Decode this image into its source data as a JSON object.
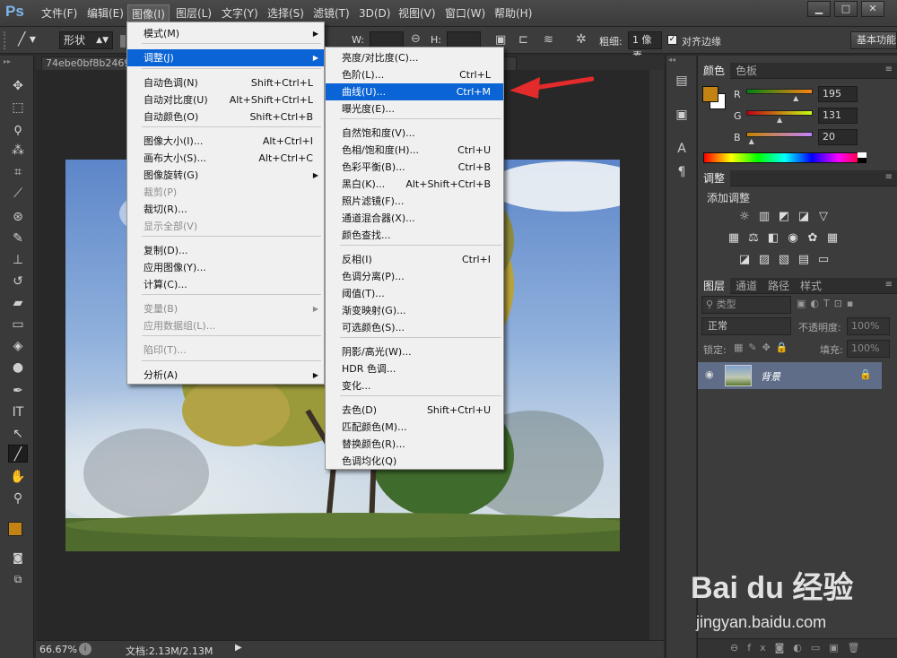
{
  "app": {
    "logo": "Ps"
  },
  "menubar": [
    "文件(F)",
    "编辑(E)",
    "图像(I)",
    "图层(L)",
    "文字(Y)",
    "选择(S)",
    "滤镜(T)",
    "3D(D)",
    "视图(V)",
    "窗口(W)",
    "帮助(H)"
  ],
  "window_controls": {
    "min": "▁",
    "max": "□",
    "close": "✕"
  },
  "options": {
    "shape_mode": "形状",
    "w_label": "W:",
    "h_label": "H:",
    "weight_label": "粗细:",
    "weight_value": "1 像素",
    "align_edges": "对齐边缘",
    "workspace": "基本功能"
  },
  "document": {
    "tab_title": "74ebe0bf8b24692",
    "zoom": "66.67%",
    "doc_info": "文档:2.13M/2.13M"
  },
  "image_menu": {
    "items": [
      {
        "label": "模式(M)",
        "shortcut": "",
        "submenu": true,
        "disabled": false
      },
      {
        "label": "调整(J)",
        "shortcut": "",
        "submenu": true,
        "disabled": false,
        "highlight": true
      },
      {
        "label": "自动色调(N)",
        "shortcut": "Shift+Ctrl+L",
        "disabled": false
      },
      {
        "label": "自动对比度(U)",
        "shortcut": "Alt+Shift+Ctrl+L",
        "disabled": false
      },
      {
        "label": "自动颜色(O)",
        "shortcut": "Shift+Ctrl+B",
        "disabled": false
      },
      {
        "label": "图像大小(I)...",
        "shortcut": "Alt+Ctrl+I",
        "disabled": false
      },
      {
        "label": "画布大小(S)...",
        "shortcut": "Alt+Ctrl+C",
        "disabled": false
      },
      {
        "label": "图像旋转(G)",
        "shortcut": "",
        "submenu": true,
        "disabled": false
      },
      {
        "label": "裁剪(P)",
        "shortcut": "",
        "disabled": true
      },
      {
        "label": "裁切(R)...",
        "shortcut": "",
        "disabled": false
      },
      {
        "label": "显示全部(V)",
        "shortcut": "",
        "disabled": true
      },
      {
        "label": "复制(D)...",
        "shortcut": "",
        "disabled": false
      },
      {
        "label": "应用图像(Y)...",
        "shortcut": "",
        "disabled": false
      },
      {
        "label": "计算(C)...",
        "shortcut": "",
        "disabled": false
      },
      {
        "label": "变量(B)",
        "shortcut": "",
        "submenu": true,
        "disabled": true
      },
      {
        "label": "应用数据组(L)...",
        "shortcut": "",
        "disabled": true
      },
      {
        "label": "陷印(T)...",
        "shortcut": "",
        "disabled": true
      },
      {
        "label": "分析(A)",
        "shortcut": "",
        "submenu": true,
        "disabled": false
      }
    ]
  },
  "adjust_menu": {
    "items": [
      {
        "label": "亮度/对比度(C)...",
        "shortcut": ""
      },
      {
        "label": "色阶(L)...",
        "shortcut": "Ctrl+L"
      },
      {
        "label": "曲线(U)...",
        "shortcut": "Ctrl+M",
        "highlight": true
      },
      {
        "label": "曝光度(E)...",
        "shortcut": ""
      },
      {
        "label": "自然饱和度(V)...",
        "shortcut": ""
      },
      {
        "label": "色相/饱和度(H)...",
        "shortcut": "Ctrl+U"
      },
      {
        "label": "色彩平衡(B)...",
        "shortcut": "Ctrl+B"
      },
      {
        "label": "黑白(K)...",
        "shortcut": "Alt+Shift+Ctrl+B"
      },
      {
        "label": "照片滤镜(F)...",
        "shortcut": ""
      },
      {
        "label": "通道混合器(X)...",
        "shortcut": ""
      },
      {
        "label": "颜色查找...",
        "shortcut": ""
      },
      {
        "label": "反相(I)",
        "shortcut": "Ctrl+I"
      },
      {
        "label": "色调分离(P)...",
        "shortcut": ""
      },
      {
        "label": "阈值(T)...",
        "shortcut": ""
      },
      {
        "label": "渐变映射(G)...",
        "shortcut": ""
      },
      {
        "label": "可选颜色(S)...",
        "shortcut": ""
      },
      {
        "label": "阴影/高光(W)...",
        "shortcut": ""
      },
      {
        "label": "HDR 色调...",
        "shortcut": ""
      },
      {
        "label": "变化...",
        "shortcut": ""
      },
      {
        "label": "去色(D)",
        "shortcut": "Shift+Ctrl+U"
      },
      {
        "label": "匹配颜色(M)...",
        "shortcut": ""
      },
      {
        "label": "替换颜色(R)...",
        "shortcut": ""
      },
      {
        "label": "色调均化(Q)",
        "shortcut": ""
      }
    ]
  },
  "color_panel": {
    "tabs": [
      "颜色",
      "色板"
    ],
    "r_label": "R",
    "g_label": "G",
    "b_label": "B",
    "r": "195",
    "g": "131",
    "b": "20",
    "r_level": 0.765,
    "g_level": 0.514,
    "b_level": 0.078,
    "foreground": "#c38314"
  },
  "adjustments_panel": {
    "title": "调整",
    "subtitle": "添加调整"
  },
  "layers_panel": {
    "tabs": [
      "图层",
      "通道",
      "路径",
      "样式"
    ],
    "filter": "类型",
    "blend_mode": "正常",
    "opacity_label": "不透明度:",
    "opacity": "100%",
    "lock_label": "锁定:",
    "fill_label": "填充:",
    "fill": "100%",
    "layer_name": "背景"
  },
  "watermark": {
    "brand": "Bai du 经验",
    "url": "jingyan.baidu.com"
  }
}
